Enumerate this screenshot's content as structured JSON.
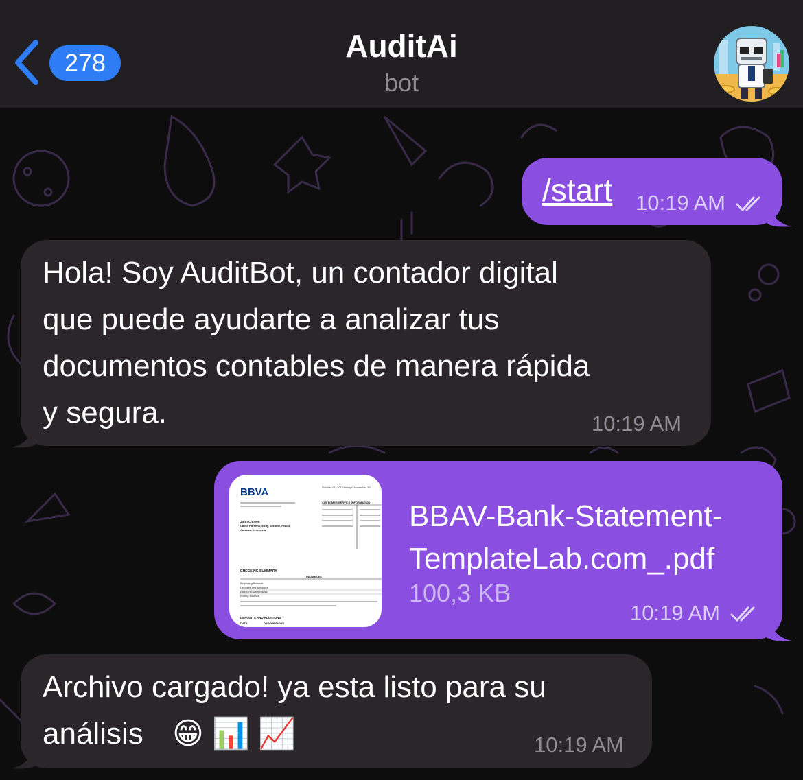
{
  "header": {
    "back_count": "278",
    "title": "AuditAi",
    "subtitle": "bot"
  },
  "messages": {
    "start": {
      "text": "/start",
      "time": "10:19 AM"
    },
    "greeting": {
      "lines": [
        "Hola! Soy AuditBot, un contador digital",
        "que puede ayudarte a analizar tus",
        "documentos contables de manera rápida",
        "y segura."
      ],
      "time": "10:19 AM"
    },
    "file": {
      "name_line1": "BBAV-Bank-Statement-",
      "name_line2": "TemplateLab.com_.pdf",
      "size": "100,3 KB",
      "time": "10:19 AM",
      "preview": {
        "brand": "BBVA",
        "account_holder": "John Chosen",
        "address_1": "Called Parnenu, Edify, Tocome, Piso 3,",
        "address_2": "Caracas, Venezuela",
        "section_1": "CHECKING SUMMARY",
        "col_instances": "INSTANCES",
        "rows": [
          "Beginning Balance",
          "Deposits and additions",
          "Electronic withdrawals",
          "Ending Balance"
        ],
        "section_2": "DEPOSITS AND ADDITIONS",
        "col_date": "DATE",
        "col_desc": "DESCRIPTIONS",
        "service_header": "CUSTOMER SERVICE INFORMATION",
        "date_line": "October 01, 2019 through November 30"
      }
    },
    "uploaded": {
      "line1": "Archivo cargado! ya esta listo para su",
      "line2": "análisis",
      "emojis": "😁 📊 📈",
      "time": "10:19 AM"
    }
  },
  "colors": {
    "outgoing": "#8a4ee0",
    "incoming": "#2a2629",
    "accent": "#2f7df6"
  }
}
